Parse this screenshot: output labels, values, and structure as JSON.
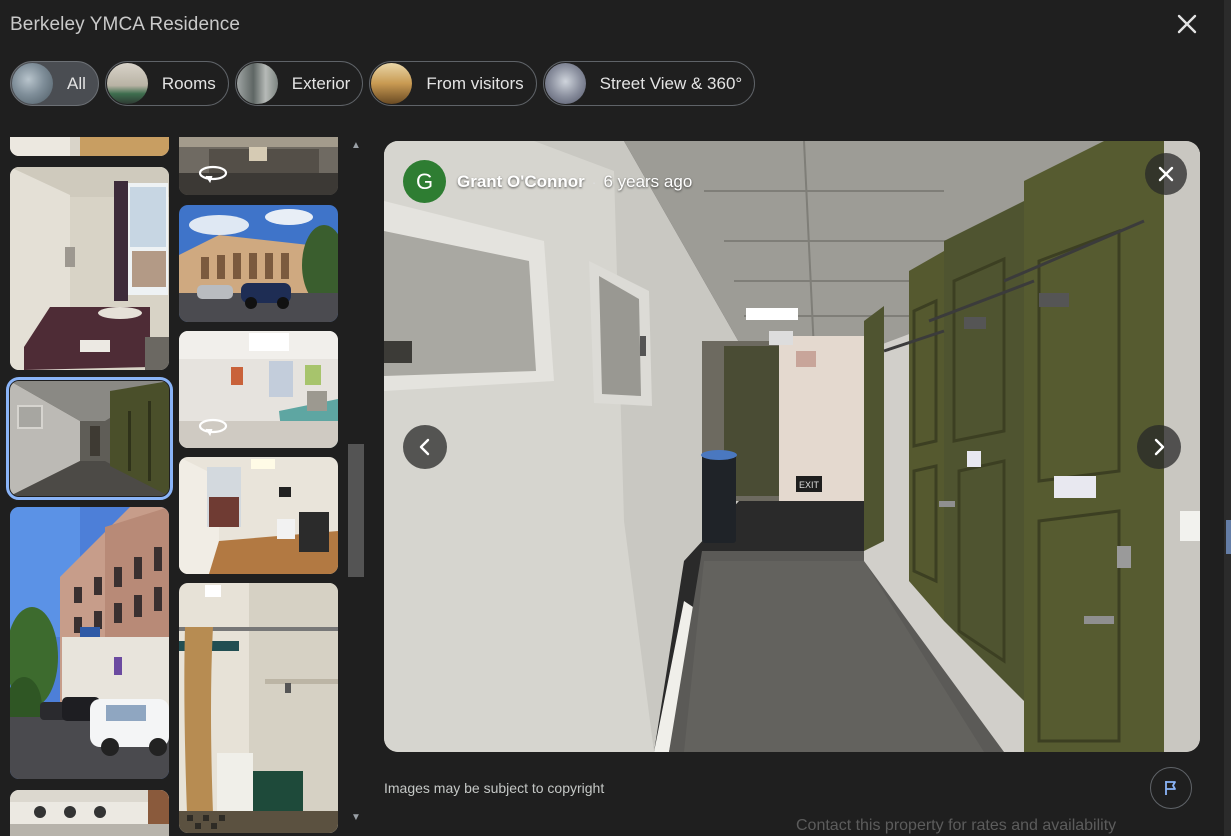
{
  "header": {
    "title": "Berkeley YMCA Residence"
  },
  "chips": [
    {
      "label": "All",
      "active": true
    },
    {
      "label": "Rooms",
      "active": false
    },
    {
      "label": "Exterior",
      "active": false
    },
    {
      "label": "From visitors",
      "active": false
    },
    {
      "label": "Street View & 360°",
      "active": false
    }
  ],
  "viewer": {
    "avatar_letter": "G",
    "author": "Grant O'Connor",
    "separator": "·",
    "time": "6 years ago"
  },
  "footer": {
    "copyright": "Images may be subject to copyright",
    "behind_text": "Contact this property for rates and availability"
  },
  "colors": {
    "accent": "#8ab4f8",
    "avatar": "#2e7d32",
    "background": "#1f1f1f"
  }
}
